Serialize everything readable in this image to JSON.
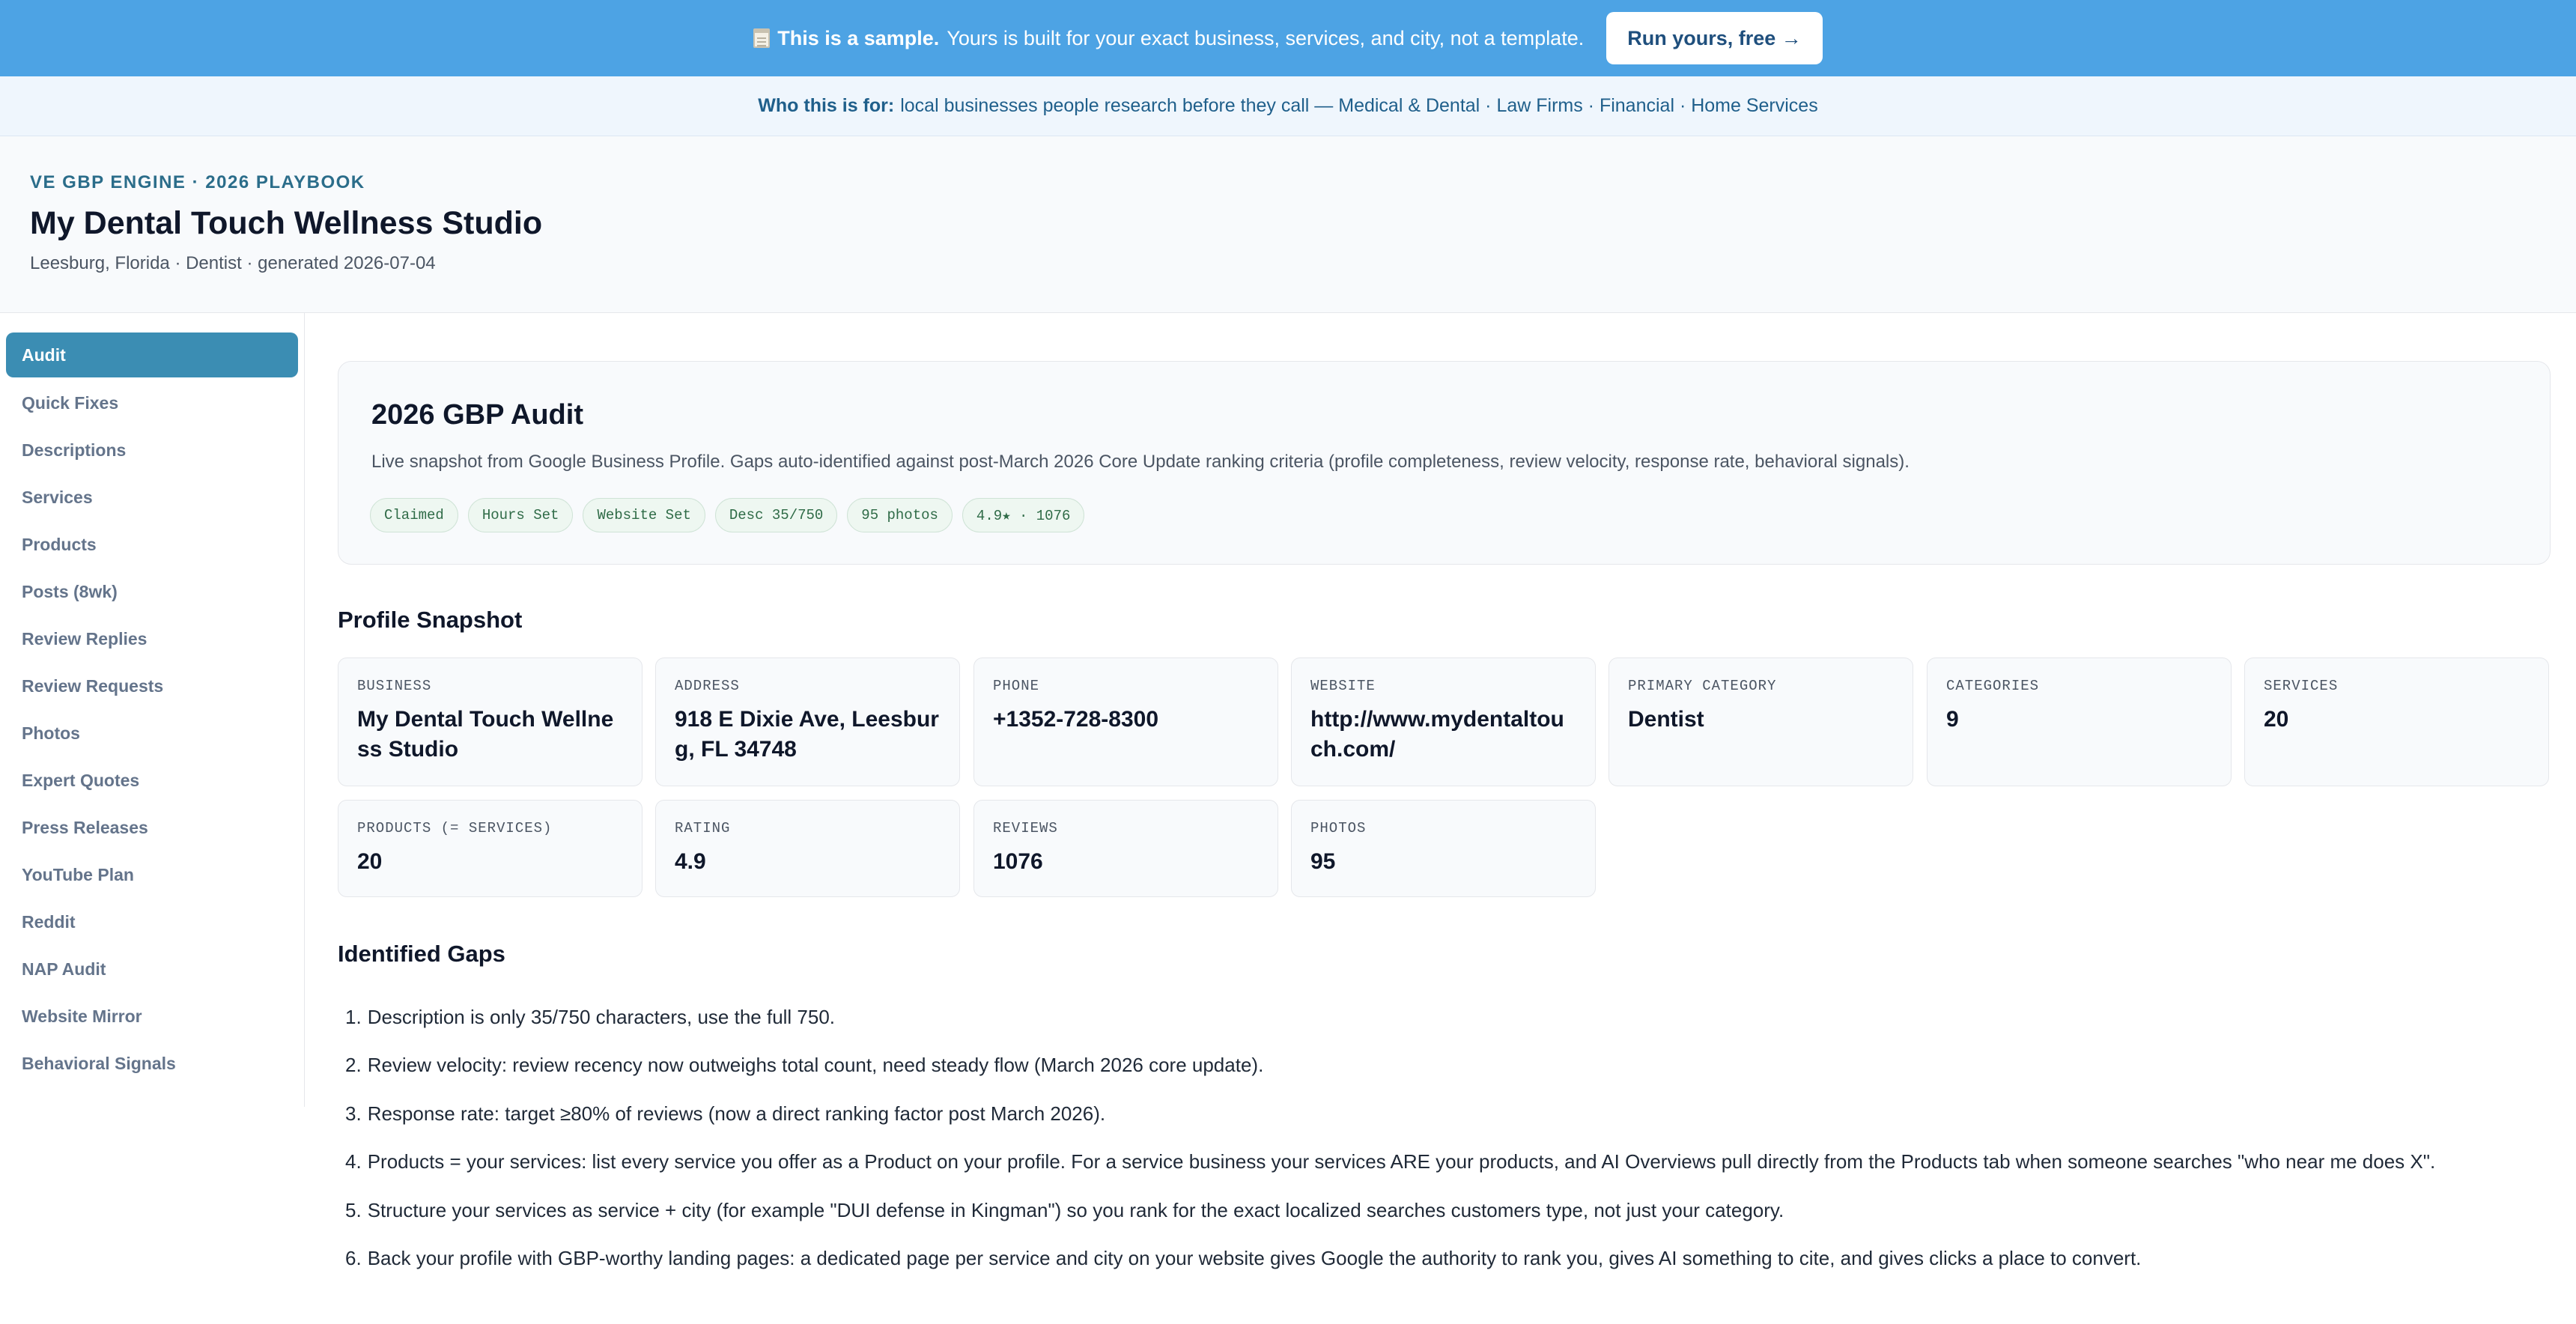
{
  "banner": {
    "icon": "notepad-icon",
    "bold": "This is a sample.",
    "text": "Yours is built for your exact business, services, and city, not a template.",
    "cta": "Run yours, free →"
  },
  "audience": {
    "label": "Who this is for:",
    "text": "local businesses people research before they call — Medical & Dental · Law Firms · Financial · Home Services"
  },
  "header": {
    "eyebrow": "VE GBP ENGINE · 2026 PLAYBOOK",
    "title": "My Dental Touch Wellness Studio",
    "subtitle": "Leesburg, Florida · Dentist · generated 2026-07-04"
  },
  "sidebar": {
    "active_index": 0,
    "items": [
      "Audit",
      "Quick Fixes",
      "Descriptions",
      "Services",
      "Products",
      "Posts (8wk)",
      "Review Replies",
      "Review Requests",
      "Photos",
      "Expert Quotes",
      "Press Releases",
      "YouTube Plan",
      "Reddit",
      "NAP Audit",
      "Website Mirror",
      "Behavioral Signals"
    ]
  },
  "audit": {
    "title": "2026 GBP Audit",
    "description": "Live snapshot from Google Business Profile. Gaps auto-identified against post-March 2026 Core Update ranking criteria (profile completeness, review velocity, response rate, behavioral signals).",
    "chips": [
      "Claimed",
      "Hours Set",
      "Website Set",
      "Desc 35/750",
      "95 photos",
      "4.9★ · 1076"
    ]
  },
  "snapshot": {
    "title": "Profile Snapshot",
    "stats": [
      {
        "label": "BUSINESS",
        "value": "My Dental Touch Wellness Studio"
      },
      {
        "label": "ADDRESS",
        "value": "918 E Dixie Ave, Leesburg, FL 34748"
      },
      {
        "label": "PHONE",
        "value": "+1352-728-8300"
      },
      {
        "label": "WEBSITE",
        "value": "http://www.mydentaltouch.com/"
      },
      {
        "label": "PRIMARY CATEGORY",
        "value": "Dentist"
      },
      {
        "label": "CATEGORIES",
        "value": "9"
      },
      {
        "label": "SERVICES",
        "value": "20"
      },
      {
        "label": "PRODUCTS (= SERVICES)",
        "value": "20"
      },
      {
        "label": "RATING",
        "value": "4.9"
      },
      {
        "label": "REVIEWS",
        "value": "1076"
      },
      {
        "label": "PHOTOS",
        "value": "95"
      }
    ]
  },
  "gaps": {
    "title": "Identified Gaps",
    "items": [
      "Description is only 35/750 characters, use the full 750.",
      "Review velocity: review recency now outweighs total count, need steady flow (March 2026 core update).",
      "Response rate: target ≥80% of reviews (now a direct ranking factor post March 2026).",
      "Products = your services: list every service you offer as a Product on your profile. For a service business your services ARE your products, and AI Overviews pull directly from the Products tab when someone searches \"who near me does X\".",
      "Structure your services as service + city (for example \"DUI defense in Kingman\") so you rank for the exact localized searches customers type, not just your category.",
      "Back your profile with GBP-worthy landing pages: a dedicated page per service and city on your website gives Google the authority to rank you, gives AI something to cite, and gives clicks a place to convert."
    ]
  }
}
